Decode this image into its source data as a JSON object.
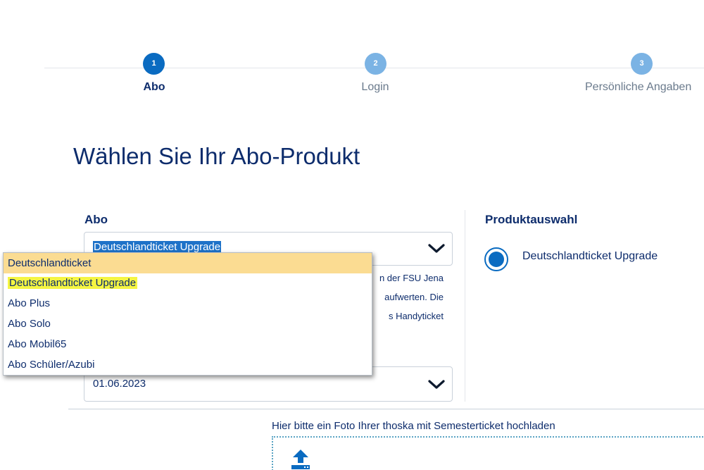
{
  "stepper": {
    "steps": [
      {
        "number": "1",
        "label": "Abo"
      },
      {
        "number": "2",
        "label": "Login"
      },
      {
        "number": "3",
        "label": "Persönliche Angaben"
      }
    ]
  },
  "page_title": "Wählen Sie Ihr Abo-Produkt",
  "abo": {
    "label": "Abo",
    "selected_value": "Deutschlandticket Upgrade",
    "options": [
      "Deutschlandticket",
      "Deutschlandticket Upgrade",
      "Abo Plus",
      "Abo Solo",
      "Abo Mobil65",
      "Abo Schüler/Azubi"
    ],
    "hovered_option": "Deutschlandticket",
    "description_lines": [
      "n der FSU Jena",
      "aufwerten. Die",
      "s Handyticket"
    ]
  },
  "start_date": {
    "value": "01.06.2023"
  },
  "product_selection": {
    "title": "Produktauswahl",
    "selected_product": "Deutschlandticket Upgrade",
    "selected": true
  },
  "upload": {
    "label": "Hier bitte ein Foto Ihrer thoska mit Semesterticket hochladen"
  },
  "icons": {
    "chevron": "chevron-down-icon",
    "upload": "upload-icon"
  },
  "colors": {
    "primary": "#0a6bc1",
    "primary_light": "#7bb3e4",
    "text_dark": "#0d2c6c",
    "hover": "#fbdc92",
    "marker": "#f5f542"
  }
}
